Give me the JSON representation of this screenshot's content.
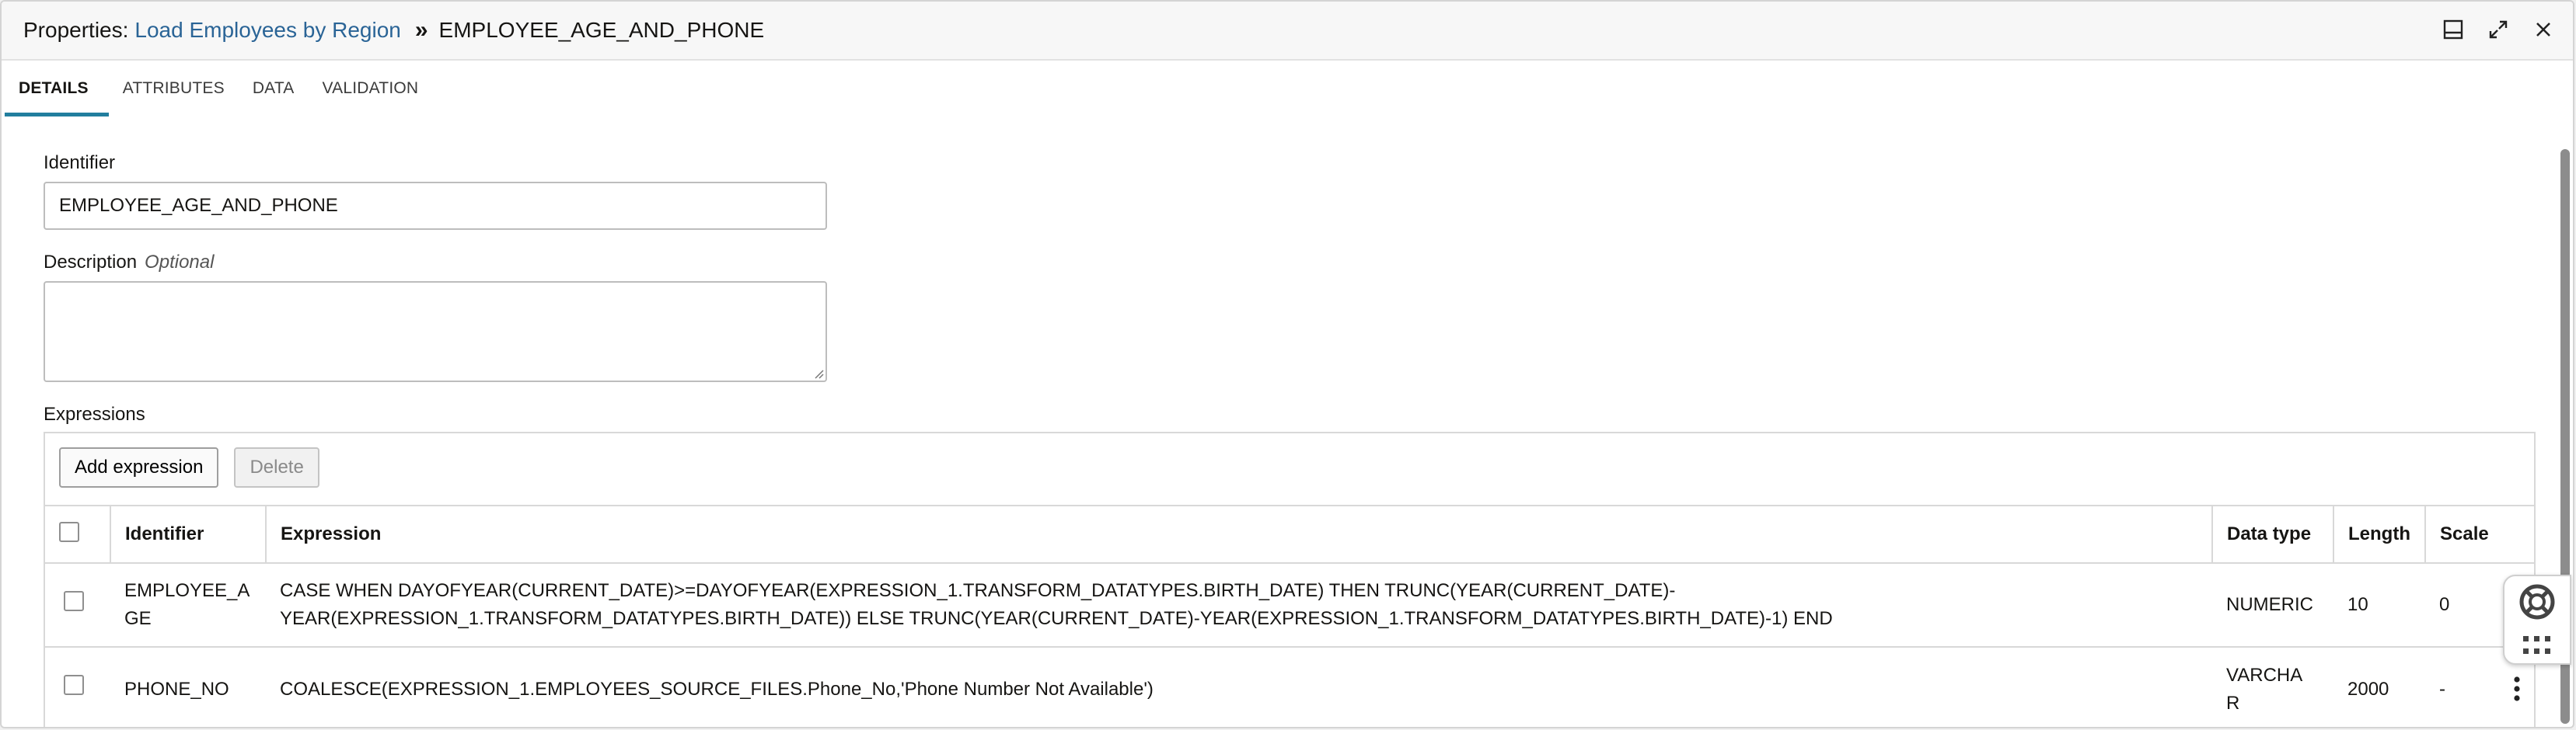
{
  "header": {
    "prefix": "Properties:",
    "link": "Load Employees by Region",
    "separator": "»",
    "current": "EMPLOYEE_AGE_AND_PHONE"
  },
  "tabs": [
    {
      "label": "DETAILS",
      "active": true
    },
    {
      "label": "ATTRIBUTES",
      "active": false
    },
    {
      "label": "DATA",
      "active": false
    },
    {
      "label": "VALIDATION",
      "active": false
    }
  ],
  "form": {
    "identifier_label": "Identifier",
    "identifier_value": "EMPLOYEE_AGE_AND_PHONE",
    "description_label": "Description",
    "description_optional": "Optional",
    "description_value": "",
    "expressions_label": "Expressions"
  },
  "toolbar": {
    "add_label": "Add expression",
    "delete_label": "Delete"
  },
  "table": {
    "headers": [
      "Identifier",
      "Expression",
      "Data type",
      "Length",
      "Scale"
    ],
    "rows": [
      {
        "identifier": "EMPLOYEE_A\nGE",
        "expression": "CASE WHEN DAYOFYEAR(CURRENT_DATE)>=DAYOFYEAR(EXPRESSION_1.TRANSFORM_DATATYPES.BIRTH_DATE) THEN TRUNC(YEAR(CURRENT_DATE)-\nYEAR(EXPRESSION_1.TRANSFORM_DATATYPES.BIRTH_DATE)) ELSE TRUNC(YEAR(CURRENT_DATE)-YEAR(EXPRESSION_1.TRANSFORM_DATATYPES.BIRTH_DATE)-1) END",
        "data_type": "NUMERIC",
        "length": "10",
        "scale": "0"
      },
      {
        "identifier": "PHONE_NO",
        "expression": "COALESCE(EXPRESSION_1.EMPLOYEES_SOURCE_FILES.Phone_No,'Phone Number Not Available')",
        "data_type": "VARCHA\nR",
        "length": "2000",
        "scale": "-"
      }
    ]
  },
  "icons": {
    "minimize": "panel-bottom-icon",
    "expand": "expand-icon",
    "close": "close-icon",
    "help": "lifebuoy-icon",
    "apps": "grid-dots-icon",
    "row_menu": "kebab-menu-icon"
  },
  "colors": {
    "link": "#2a6496",
    "active_tab_underline": "#227e9e"
  }
}
